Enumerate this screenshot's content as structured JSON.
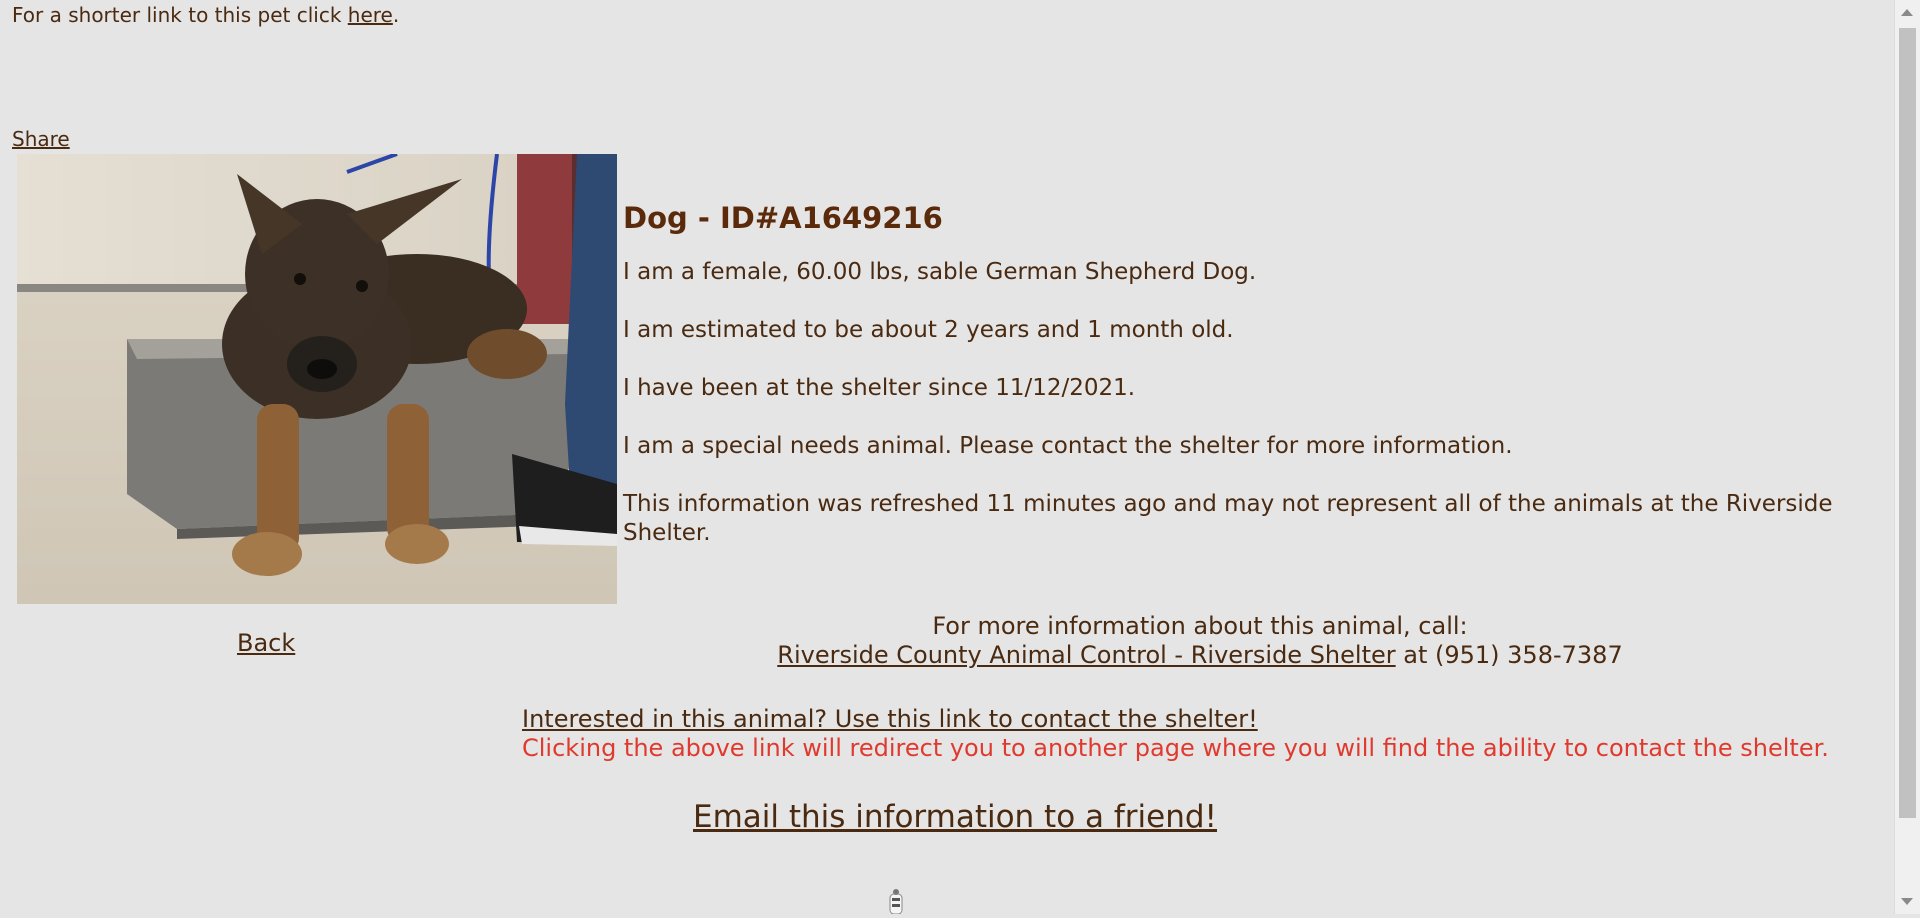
{
  "top_notice": {
    "prefix": "For a shorter link to this pet click ",
    "link": "here",
    "suffix": "."
  },
  "share_label": "Share",
  "pet": {
    "title": "Dog - ID#A1649216",
    "lines": [
      "I am a female, 60.00 lbs, sable German Shepherd Dog.",
      "I am estimated to be about 2 years and 1 month old.",
      "I have been at the shelter since 11/12/2021.",
      "I am a special needs animal. Please contact the shelter for more information.",
      "This information was refreshed 11 minutes ago and may not represent all of the animals at the Riverside Shelter."
    ]
  },
  "back_label": "Back",
  "contact": {
    "heading": "For more information about this animal, call:",
    "shelter_link": "Riverside County Animal Control - Riverside Shelter",
    "phone_text": " at (951) 358-7387"
  },
  "interest": {
    "link": "Interested in this animal? Use this link to contact the shelter!",
    "note": "Clicking the above link will redirect you to another page where you will find the ability to contact the shelter."
  },
  "email_label": "Email this information to a friend!",
  "colors": {
    "background": "#e5e5e5",
    "text": "#4a2a10",
    "warning": "#e03a2e"
  }
}
